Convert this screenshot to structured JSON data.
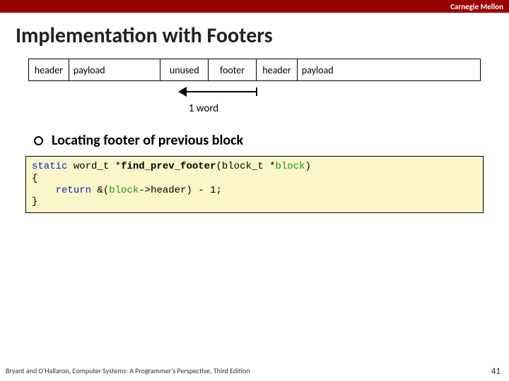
{
  "topbar": {
    "text": "Carnegie Mellon"
  },
  "title": "Implementation with Footers",
  "cells": {
    "header1": "header",
    "payload1": "payload",
    "unused": "unused",
    "footer": "footer",
    "header2": "header",
    "payload2": "payload"
  },
  "arrow_label": "1 word",
  "bullet": "Locating footer of previous block",
  "code": {
    "kw_static": "static",
    "type": " word_t *",
    "fn": "find_prev_footer",
    "sig_open": "(block_t *",
    "arg": "block",
    "sig_close": ")",
    "brace_open": "{",
    "indent": "    ",
    "kw_return": "return",
    "expr_pre": " &(",
    "expr_var": "block",
    "expr_post": "->header) - 1;",
    "brace_close": "}"
  },
  "footer_left": "Bryant and O'Hallaron, Computer Systems: A Programmer's Perspective, Third Edition",
  "page_number": "41"
}
